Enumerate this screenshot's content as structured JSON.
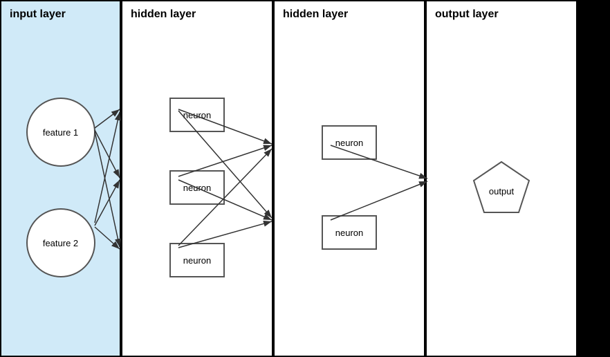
{
  "layers": [
    {
      "id": "input",
      "title": "input layer",
      "type": "input",
      "nodes": [
        "feature 1",
        "feature 2"
      ]
    },
    {
      "id": "hidden1",
      "title": "hidden layer",
      "type": "hidden",
      "nodes": [
        "neuron",
        "neuron",
        "neuron"
      ]
    },
    {
      "id": "hidden2",
      "title": "hidden layer",
      "type": "hidden",
      "nodes": [
        "neuron",
        "neuron"
      ]
    },
    {
      "id": "output",
      "title": "output layer",
      "type": "output",
      "nodes": [
        "output"
      ]
    }
  ]
}
